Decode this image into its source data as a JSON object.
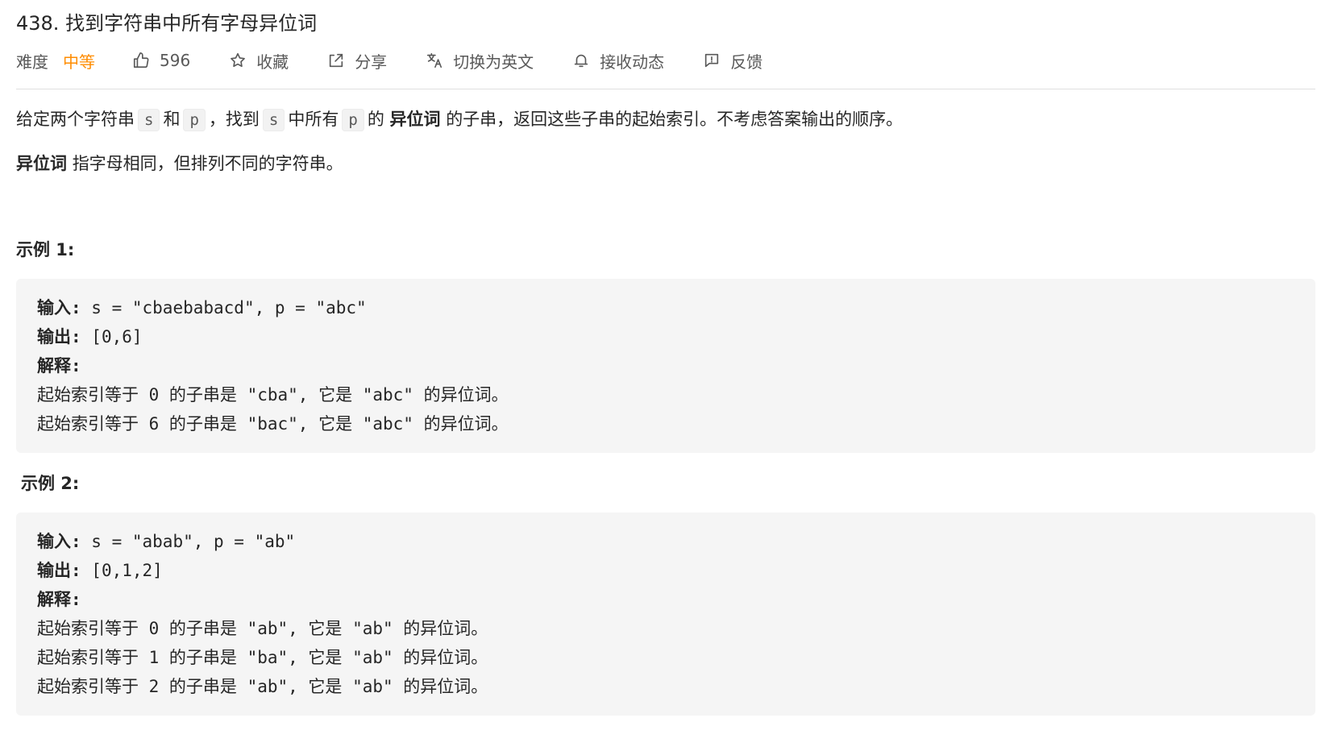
{
  "header": {
    "title": "438. 找到字符串中所有字母异位词"
  },
  "meta": {
    "difficulty_label": "难度",
    "difficulty_value": "中等",
    "likes_count": "596",
    "favorite_label": "收藏",
    "share_label": "分享",
    "switch_lang_label": "切换为英文",
    "subscribe_label": "接收动态",
    "feedback_label": "反馈",
    "difficulty_color": "#ff8c00"
  },
  "description": {
    "p1_part1": "给定两个字符串",
    "code_s": "s",
    "p1_part2": "和",
    "code_p": "p",
    "p1_part3": "，找到",
    "code_s2": "s",
    "p1_part4": "中所有",
    "code_p2": "p",
    "p1_part5": "的",
    "p1_bold": "异位词",
    "p1_part6": "的子串，返回这些子串的起始索引。不考虑答案输出的顺序。",
    "p2_bold": "异位词",
    "p2_rest": "指字母相同，但排列不同的字符串。"
  },
  "examples": [
    {
      "title": "示例 1:",
      "input_label": "输入: ",
      "input_value": "s = \"cbaebabacd\", p = \"abc\"",
      "output_label": "输出: ",
      "output_value": "[0,6]",
      "explain_label": "解释:",
      "explain_lines": [
        "起始索引等于 0 的子串是 \"cba\", 它是 \"abc\" 的异位词。",
        "起始索引等于 6 的子串是 \"bac\", 它是 \"abc\" 的异位词。"
      ]
    },
    {
      "title": "示例 2:",
      "input_label": "输入: ",
      "input_value": "s = \"abab\", p = \"ab\"",
      "output_label": "输出: ",
      "output_value": "[0,1,2]",
      "explain_label": "解释:",
      "explain_lines": [
        "起始索引等于 0 的子串是 \"ab\", 它是 \"ab\" 的异位词。",
        "起始索引等于 1 的子串是 \"ba\", 它是 \"ab\" 的异位词。",
        "起始索引等于 2 的子串是 \"ab\", 它是 \"ab\" 的异位词。"
      ]
    }
  ],
  "icons": {
    "likes": "thumbs-up-icon",
    "favorite": "star-icon",
    "share": "share-icon",
    "switch_lang": "translate-icon",
    "subscribe": "bell-icon",
    "feedback": "feedback-icon"
  }
}
